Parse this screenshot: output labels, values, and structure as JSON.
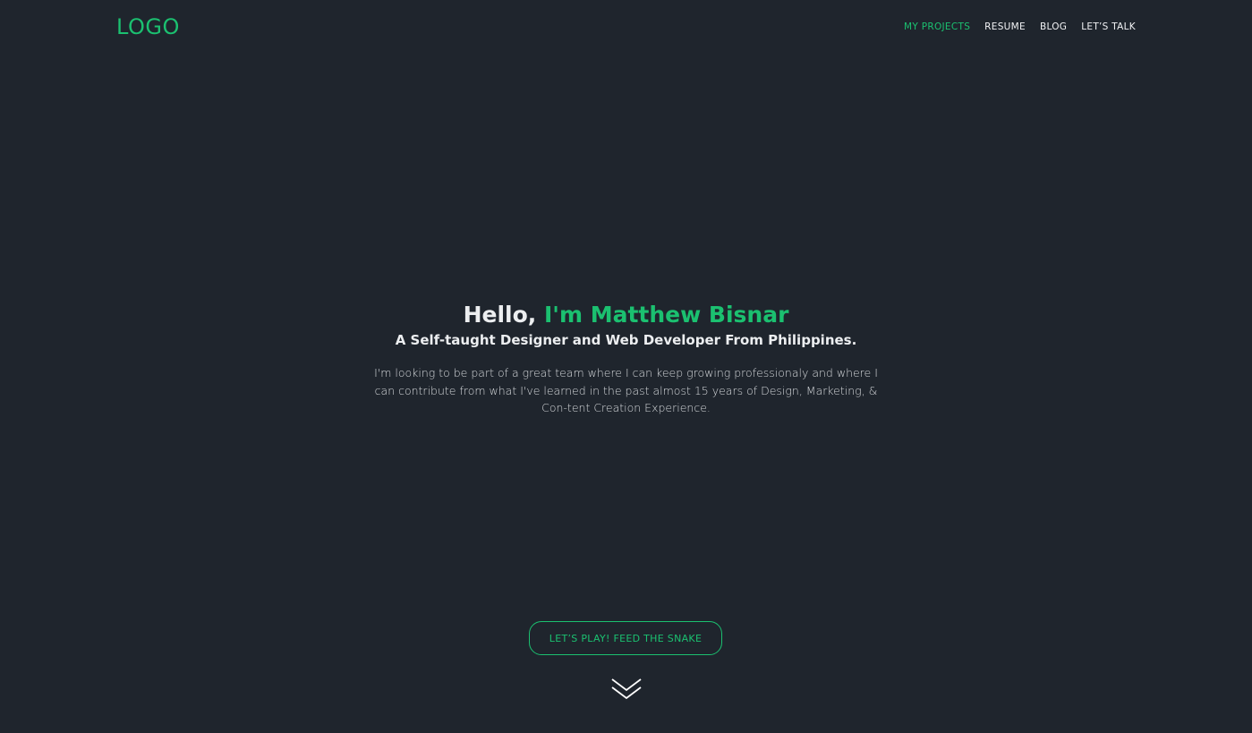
{
  "header": {
    "logo": "LOGO",
    "nav": [
      {
        "label": "MY PROJECTS",
        "active": true
      },
      {
        "label": "RESUME",
        "active": false
      },
      {
        "label": "BLOG",
        "active": false
      },
      {
        "label": "LET’S TALK",
        "active": false
      }
    ]
  },
  "hero": {
    "greeting": "Hello,",
    "name": "I'm Matthew Bisnar",
    "subtitle": "A Self-taught Designer and Web Developer From Philippines.",
    "description": "I'm looking to be part of a great team where I can keep growing professionaly and where I can contribute from what I've learned in the past almost 15 years of Design, Marketing, & Con-tent Creation Experience."
  },
  "cta": {
    "label": "LET’S PLAY! FEED THE SNAKE"
  },
  "scroll": {
    "icon": "double-chevron-down-icon"
  },
  "colors": {
    "background": "#1f252d",
    "accent": "#1bc070",
    "text": "#eceef0"
  }
}
